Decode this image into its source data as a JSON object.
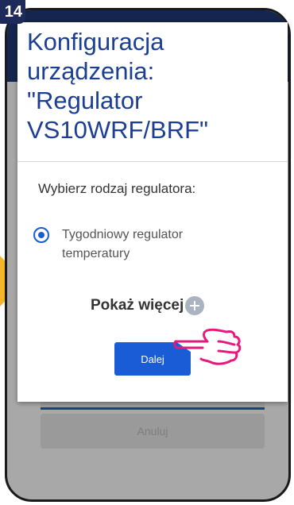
{
  "step_number": "14",
  "dialog": {
    "title": "Konfiguracja\nurządzenia:\n\"Regulator\nVS10WRF/BRF\"",
    "prompt": "Wybierz rodzaj regulatora:",
    "option_label": "Tygodniowy regulator temperatury",
    "option_selected": true,
    "show_more_label": "Pokaż więcej",
    "next_button_label": "Dalej"
  },
  "background": {
    "cancel_button_label": "Anuluj"
  },
  "colors": {
    "accent_blue": "#1a5bd6",
    "title_blue": "#1c3f94",
    "header_navy": "#14264f",
    "arrow_yellow": "#f5b52b",
    "hand_pink": "#e6197e"
  }
}
